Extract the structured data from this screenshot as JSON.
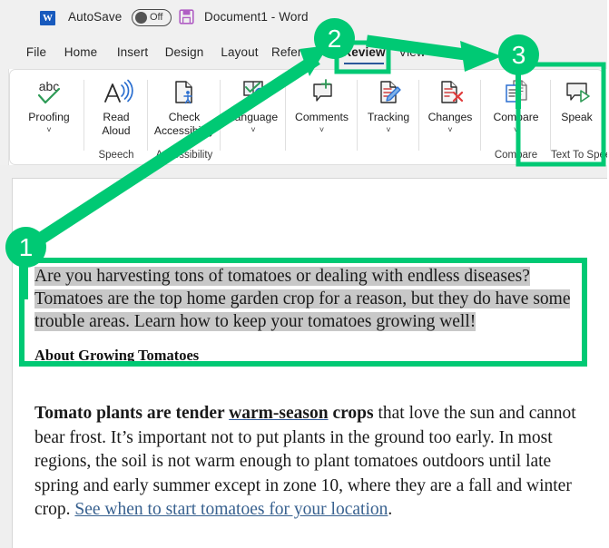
{
  "window": {
    "app_logo": "word-logo",
    "autosave_label": "AutoSave",
    "autosave_state": "Off",
    "save_icon": "save-icon",
    "document_title": "Document1  -  Word"
  },
  "tabs": [
    {
      "label": "File",
      "active": false
    },
    {
      "label": "Home",
      "active": false
    },
    {
      "label": "Insert",
      "active": false
    },
    {
      "label": "Design",
      "active": false
    },
    {
      "label": "Layout",
      "active": false
    },
    {
      "label": "References",
      "active": false
    },
    {
      "label": "Review",
      "active": true
    },
    {
      "label": "View",
      "active": false
    }
  ],
  "ribbon": {
    "groups": [
      {
        "group_label": "",
        "buttons": [
          {
            "label": "Proofing",
            "icon": "spelling-abc-check-icon",
            "chevron": "˅"
          }
        ]
      },
      {
        "group_label": "Speech",
        "buttons": [
          {
            "label": "Read\nAloud",
            "icon": "read-aloud-icon",
            "chevron": ""
          }
        ]
      },
      {
        "group_label": "Accessibility",
        "buttons": [
          {
            "label": "Check\nAccessibility",
            "icon": "check-accessibility-icon",
            "chevron": "˅"
          }
        ]
      },
      {
        "group_label": "",
        "buttons": [
          {
            "label": "Language",
            "icon": "language-globe-icon",
            "chevron": "˅"
          }
        ]
      },
      {
        "group_label": "",
        "buttons": [
          {
            "label": "Comments",
            "icon": "new-comment-icon",
            "chevron": "˅"
          }
        ]
      },
      {
        "group_label": "",
        "buttons": [
          {
            "label": "Tracking",
            "icon": "track-changes-icon",
            "chevron": "˅"
          }
        ]
      },
      {
        "group_label": "",
        "buttons": [
          {
            "label": "Changes",
            "icon": "reject-changes-icon",
            "chevron": "˅"
          }
        ]
      },
      {
        "group_label": "Compare",
        "buttons": [
          {
            "label": "Compare",
            "icon": "compare-documents-icon",
            "chevron": "˅"
          }
        ]
      },
      {
        "group_label": "Text To Speech",
        "buttons": [
          {
            "label": "Speak",
            "icon": "speak-icon",
            "chevron": ""
          }
        ]
      }
    ]
  },
  "document": {
    "intro_paragraph": "Are you harvesting tons of tomatoes or dealing with endless diseases? Tomatoes are the top home garden crop for a reason, but they do have some trouble areas. Learn how to keep your tomatoes growing well!",
    "heading": "About Growing Tomatoes",
    "body": {
      "bold_lead": "Tomato plants are tender ",
      "bold_underlined": "warm-season",
      "bold_tail": " crops",
      "text_1": " that love the sun and cannot bear frost. It’s important not to put plants in the ground too early. In most regions, the soil is not warm enough to plant tomatoes outdoors until late spring and early summer except in zone 10, where they are a fall and winter crop. ",
      "link": "See when to start tomatoes for your location",
      "text_2": "."
    }
  },
  "annotations": {
    "accent_color": "#00c974",
    "badges": [
      {
        "number": "1",
        "describes": "selected-text-highlight"
      },
      {
        "number": "2",
        "describes": "review-tab"
      },
      {
        "number": "3",
        "describes": "speak-button"
      }
    ],
    "highlight_boxes": [
      {
        "target": "intro-paragraph-selection"
      },
      {
        "target": "review-tab"
      },
      {
        "target": "text-to-speech-group"
      }
    ],
    "arrows": [
      {
        "from": "badge-1",
        "to": "review-tab"
      },
      {
        "from": "review-tab",
        "to": "badge-3"
      }
    ]
  }
}
